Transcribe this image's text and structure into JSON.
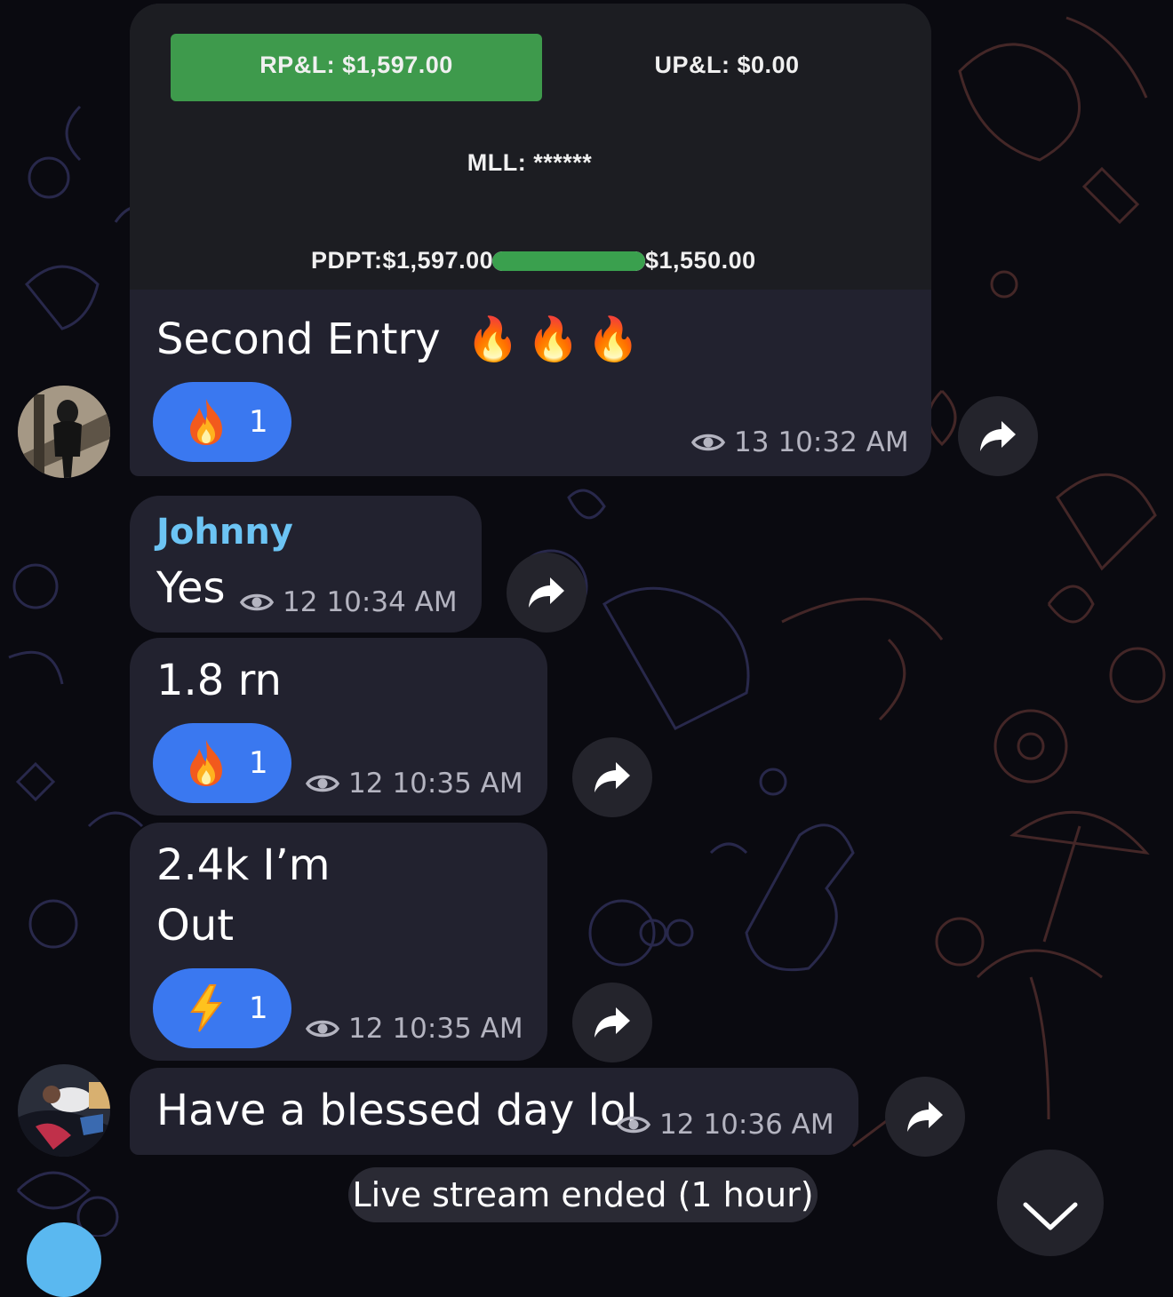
{
  "pnl_card": {
    "rpl_label": "RP&L: $1,597.00",
    "upl_label": "UP&L: $0.00",
    "mll_label": "MLL: ******",
    "pdpt_label": "PDPT:$1,597.00",
    "pdpt_target": "$1,550.00",
    "progress_fraction": 1.0,
    "rpl_color": "#3e9a4c",
    "progress_color": "#3aa04e"
  },
  "messages": [
    {
      "text": "Second Entry",
      "emoji_text": "🔥🔥🔥",
      "reaction": {
        "icon": "fire-icon",
        "count": "1"
      },
      "views": "13",
      "time": "10:32 AM"
    },
    {
      "sender": "Johnny",
      "text": "Yes",
      "views": "12",
      "time": "10:34 AM"
    },
    {
      "text": "1.8 rn",
      "reaction": {
        "icon": "fire-icon",
        "count": "1"
      },
      "views": "12",
      "time": "10:35 AM"
    },
    {
      "text_line1": "2.4k I’m",
      "text_line2": "Out",
      "reaction": {
        "icon": "lightning-icon",
        "count": "1"
      },
      "views": "12",
      "time": "10:35 AM"
    },
    {
      "text": "Have a blessed day lol",
      "views": "12",
      "time": "10:36 AM"
    }
  ],
  "service_message": "Live stream ended (1 hour)",
  "colors": {
    "bubble": "#22222f",
    "reaction": "#3a78f0",
    "sender_name": "#6cc4f4",
    "meta": "#b4b4c0"
  }
}
